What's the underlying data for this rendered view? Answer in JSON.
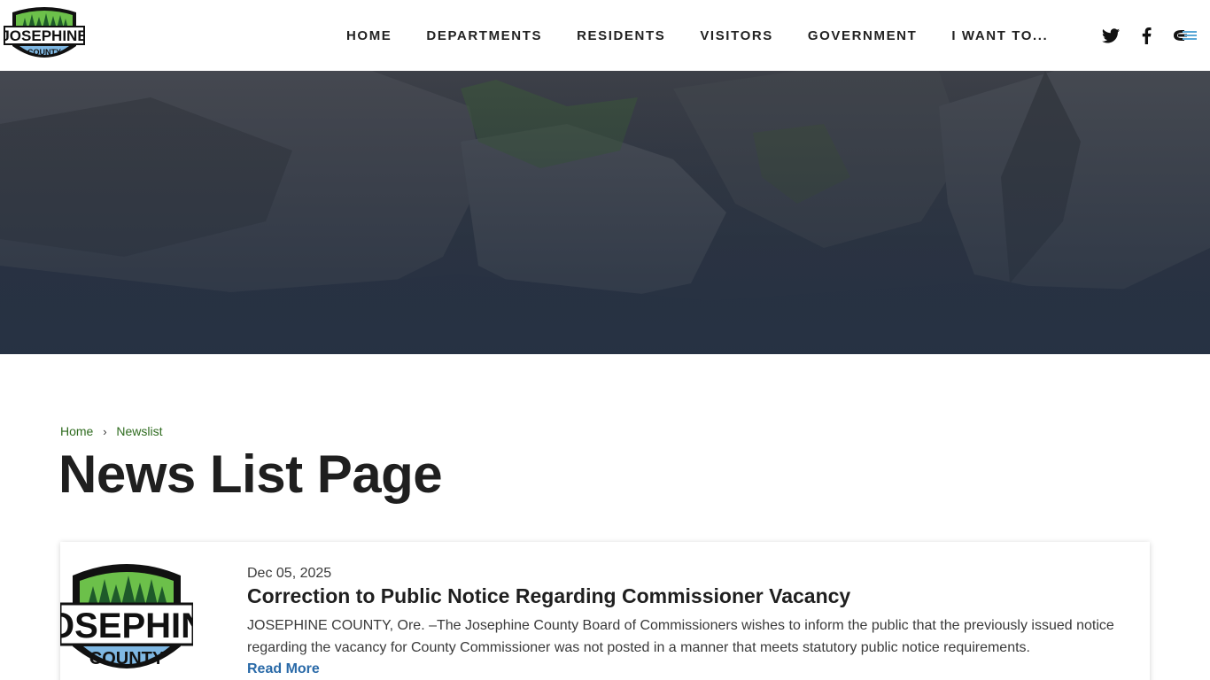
{
  "header": {
    "logo": {
      "line1": "JOSEPHINE",
      "line2": "COUNTY"
    },
    "nav": [
      {
        "label": "HOME"
      },
      {
        "label": "DEPARTMENTS"
      },
      {
        "label": "RESIDENTS"
      },
      {
        "label": "VISITORS"
      },
      {
        "label": "GOVERNMENT"
      },
      {
        "label": "I WANT TO..."
      }
    ],
    "social": [
      "twitter-icon",
      "facebook-icon",
      "share-icon"
    ]
  },
  "breadcrumb": {
    "home": "Home",
    "separator": "›",
    "current": "Newslist"
  },
  "page": {
    "title": "News List Page"
  },
  "news": [
    {
      "date": "Dec 05, 2025",
      "title": "Correction to Public Notice Regarding Commissioner Vacancy",
      "excerpt": "JOSEPHINE COUNTY, Ore. –The Josephine County Board of Commissioners wishes to inform the public that the previously issued notice regarding the vacancy for County Commissioner was not posted in a manner that meets statutory public notice requirements.",
      "read_more": "Read More",
      "logo_text": "OSEPHIN",
      "logo_sub": "COUNTY"
    }
  ],
  "colors": {
    "link_green": "#2e6b1e",
    "read_more_blue": "#2a6aa8",
    "logo_green": "#6cc04a",
    "logo_blue": "#7fb8e3",
    "logo_dark_green": "#1e5a2a"
  }
}
